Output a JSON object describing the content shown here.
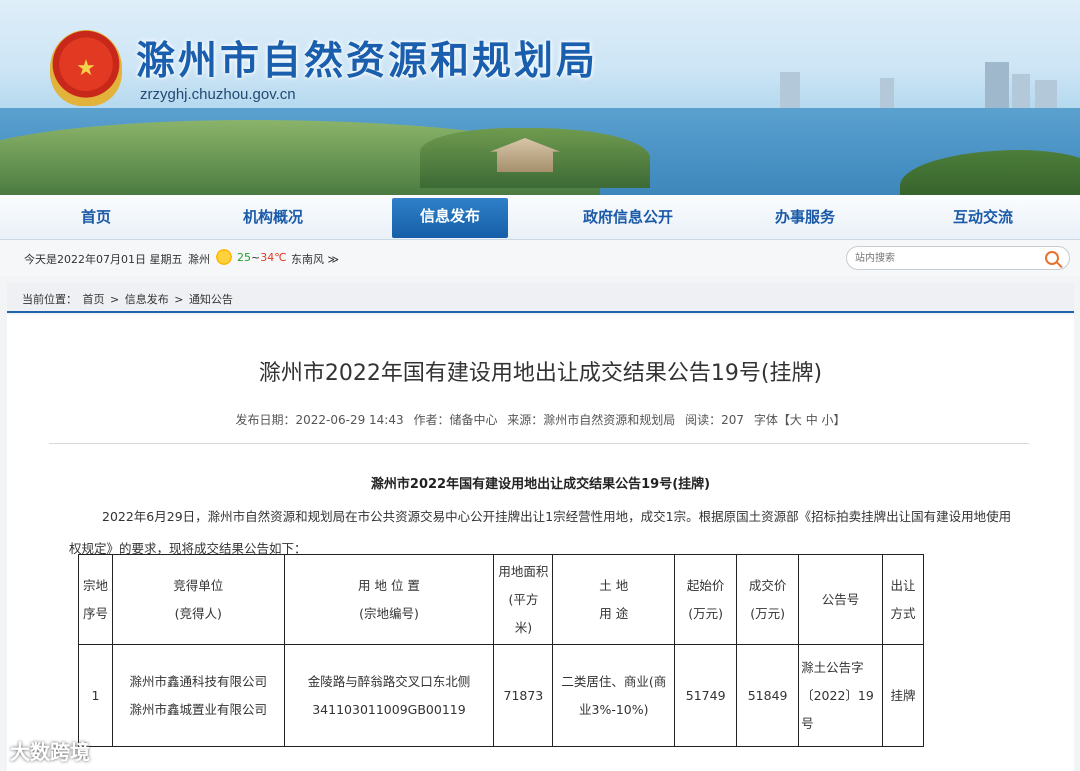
{
  "site": {
    "title": "滁州市自然资源和规划局",
    "url": "zrzyghj.chuzhou.gov.cn"
  },
  "nav": [
    {
      "label": "首页"
    },
    {
      "label": "机构概况"
    },
    {
      "label": "信息发布"
    },
    {
      "label": "政府信息公开"
    },
    {
      "label": "办事服务"
    },
    {
      "label": "互动交流"
    }
  ],
  "infobar": {
    "date": "今天是2022年07月01日 星期五",
    "city": "滁州",
    "temp_low": "25",
    "temp_sep": "~",
    "temp_high": "34℃",
    "wind": "东南风 ≫"
  },
  "search": {
    "placeholder": "站内搜索"
  },
  "breadcrumb": {
    "label": "当前位置：",
    "items": [
      "首页",
      ">",
      "信息发布",
      ">",
      "通知公告"
    ]
  },
  "article": {
    "title": "滁州市2022年国有建设用地出让成交结果公告19号(挂牌)",
    "meta": {
      "date": "发布日期：2022-06-29 14:43",
      "author": "作者：储备中心",
      "source": "来源：滁州市自然资源和规划局",
      "reads": "阅读：207",
      "font": "字体【大 中 小】"
    },
    "subtitle": "滁州市2022年国有建设用地出让成交结果公告19号(挂牌)",
    "paragraph": "2022年6月29日，滁州市自然资源和规划局在市公共资源交易中心公开挂牌出让1宗经营性用地，成交1宗。根据原国土资源部《招标拍卖挂牌出让国有建设用地使用权规定》的要求，现将成交结果公告如下：",
    "table": {
      "headers": [
        {
          "l1": "宗地",
          "l2": "序号"
        },
        {
          "l1": "竞得单位",
          "l2": "(竞得人)"
        },
        {
          "l1": "用 地 位 置",
          "l2": "(宗地编号)"
        },
        {
          "l1": "用地面积",
          "l2": "(平方",
          "l3": "米)"
        },
        {
          "l1": "土 地",
          "l2": "用 途"
        },
        {
          "l1": "起始价",
          "l2": "(万元)"
        },
        {
          "l1": "成交价",
          "l2": "(万元)"
        },
        {
          "l1": "公告号"
        },
        {
          "l1": "出让",
          "l2": "方式"
        }
      ],
      "row": {
        "no": "1",
        "winner1": "滁州市鑫通科技有限公司",
        "winner2": "滁州市鑫城置业有限公司",
        "location1": "金陵路与醉翁路交叉口东北侧",
        "location2": "341103011009GB00119",
        "area": "71873",
        "use": "二类居住、商业(商业3%-10%)",
        "start_price": "51749",
        "deal_price": "51849",
        "notice": "滁土公告字〔2022〕19号",
        "method": "挂牌"
      }
    }
  },
  "watermark": "大数跨境"
}
